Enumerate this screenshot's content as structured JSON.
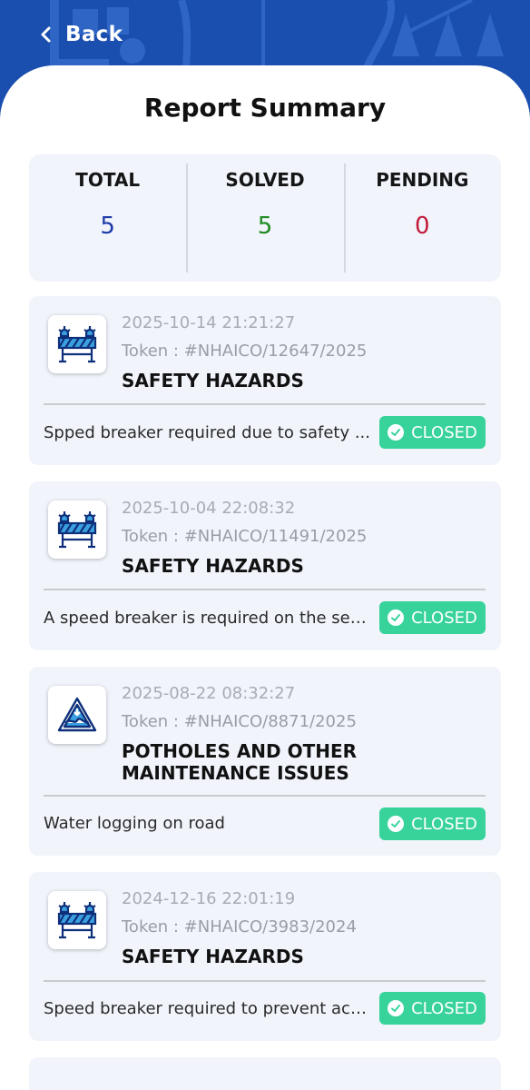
{
  "header": {
    "back_label": "Back"
  },
  "page_title": "Report Summary",
  "summary": {
    "total": {
      "label": "TOTAL",
      "value": "5",
      "color": "#1e3aa8"
    },
    "solved": {
      "label": "SOLVED",
      "value": "5",
      "color": "#1e8a22"
    },
    "pending": {
      "label": "PENDING",
      "value": "0",
      "color": "#c21a38"
    }
  },
  "reports": [
    {
      "icon": "barricade-icon",
      "date": "2025-10-14 21:21:27",
      "token": "Token : #NHAICO/12647/2025",
      "category": "SAFETY HAZARDS",
      "description": "Spped breaker required due to safety ...",
      "status": "CLOSED"
    },
    {
      "icon": "barricade-icon",
      "date": "2025-10-04 22:08:32",
      "token": "Token : #NHAICO/11491/2025",
      "category": "SAFETY HAZARDS",
      "description": "A speed breaker is required on the ser...",
      "status": "CLOSED"
    },
    {
      "icon": "pothole-icon",
      "date": "2025-08-22 08:32:27",
      "token": "Token : #NHAICO/8871/2025",
      "category": "POTHOLES AND OTHER MAINTENANCE ISSUES",
      "description": "Water logging on road",
      "status": "CLOSED"
    },
    {
      "icon": "barricade-icon",
      "date": "2024-12-16 22:01:19",
      "token": "Token : #NHAICO/3983/2024",
      "category": "SAFETY HAZARDS",
      "description": "Speed breaker required to prevent acc...",
      "status": "CLOSED"
    }
  ],
  "colors": {
    "brand": "#1a4fb0",
    "status_closed": "#37d39b"
  }
}
